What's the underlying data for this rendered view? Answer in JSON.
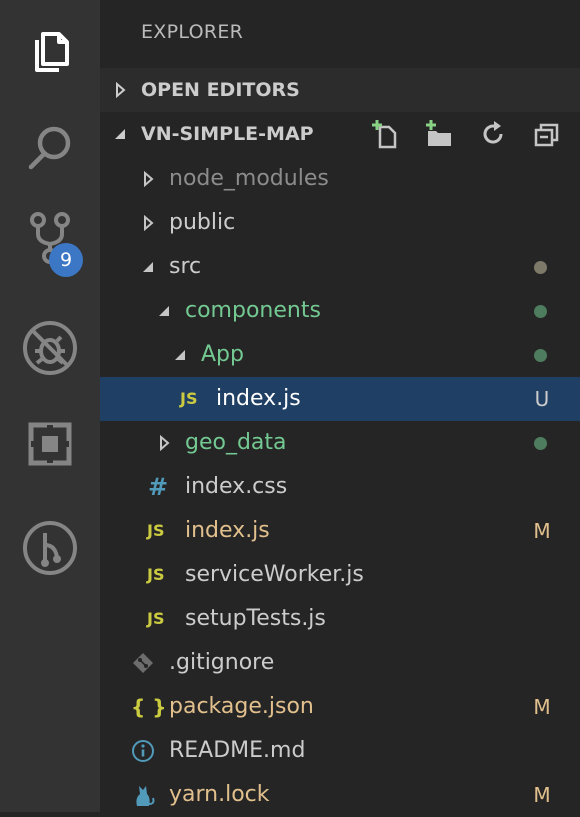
{
  "sidebar": {
    "title": "EXPLORER",
    "open_editors_label": "OPEN EDITORS",
    "project_label": "VN-SIMPLE-MAP"
  },
  "activity_bar": {
    "scm_badge": "9"
  },
  "tree": [
    {
      "name": "node_modules",
      "type": "folder",
      "collapsed": true,
      "color": "#8c8c8c",
      "status": "",
      "dot": ""
    },
    {
      "name": "public",
      "type": "folder",
      "collapsed": true,
      "color": "#cccccc",
      "status": "",
      "dot": ""
    },
    {
      "name": "src",
      "type": "folder",
      "collapsed": false,
      "color": "#cccccc",
      "status": "",
      "dot": "#7d7a6a"
    },
    {
      "name": "components",
      "type": "folder",
      "collapsed": false,
      "color": "#73c991",
      "status": "",
      "dot": "#4e7c5e"
    },
    {
      "name": "App",
      "type": "folder",
      "collapsed": false,
      "color": "#73c991",
      "status": "",
      "dot": "#4e7c5e"
    },
    {
      "name": "index.js",
      "type": "file",
      "icon": "JS",
      "color": "#ffffff",
      "status": "U",
      "dot": ""
    },
    {
      "name": "geo_data",
      "type": "folder",
      "collapsed": true,
      "color": "#73c991",
      "status": "",
      "dot": "#4e7c5e"
    },
    {
      "name": "index.css",
      "type": "file",
      "icon": "#",
      "color": "#cccccc",
      "status": "",
      "dot": ""
    },
    {
      "name": "index.js",
      "type": "file",
      "icon": "JS",
      "color": "#e2c08d",
      "status": "M",
      "dot": ""
    },
    {
      "name": "serviceWorker.js",
      "type": "file",
      "icon": "JS",
      "color": "#cccccc",
      "status": "",
      "dot": ""
    },
    {
      "name": "setupTests.js",
      "type": "file",
      "icon": "JS",
      "color": "#cccccc",
      "status": "",
      "dot": ""
    },
    {
      "name": ".gitignore",
      "type": "file",
      "icon": "git-diamond-icon",
      "color": "#cccccc",
      "status": "",
      "dot": ""
    },
    {
      "name": "package.json",
      "type": "file",
      "icon": "{ }",
      "color": "#e2c08d",
      "status": "M",
      "dot": ""
    },
    {
      "name": "README.md",
      "type": "file",
      "icon": "info-icon",
      "color": "#cccccc",
      "status": "",
      "dot": ""
    },
    {
      "name": "yarn.lock",
      "type": "file",
      "icon": "yarn-cat-icon",
      "color": "#e2c08d",
      "status": "M",
      "dot": ""
    }
  ],
  "colors": {
    "activity_bar_bg": "#333333",
    "sidebar_bg": "#252526",
    "selection_bg": "#1f3f64",
    "untracked": "#73c991",
    "modified": "#e2c08d",
    "badge": "#3c77c5"
  }
}
